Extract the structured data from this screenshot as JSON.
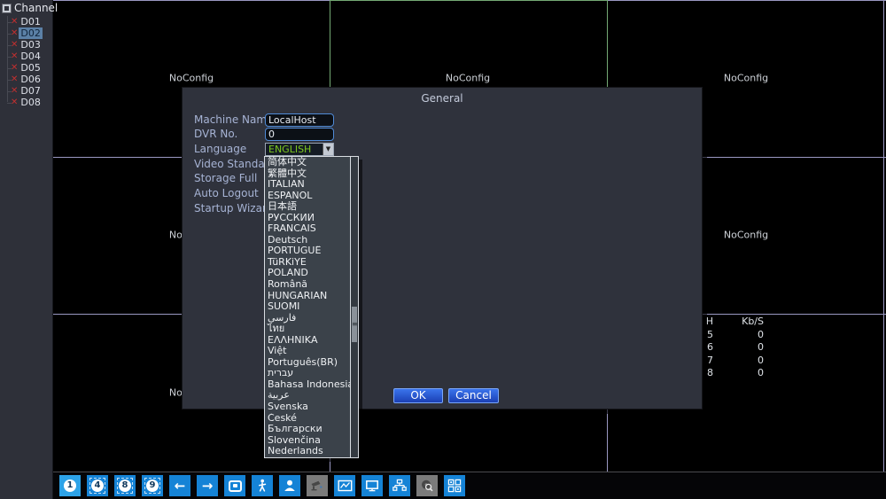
{
  "colors": {
    "accent_blue": "#1583d6",
    "active_blue": "#2da3e8",
    "combo_text_green": "#7cc81e",
    "selected_cell_border_green": "#74aa74",
    "grid_line_lavender": "#9a98c2",
    "channel_x_red": "#c22f2f",
    "button_blue": "#2356d8",
    "dialog_bg": "#2f323c"
  },
  "icons": {
    "channel_status": "✕",
    "dropdown_arrow": "▼",
    "arrow_left": "←",
    "arrow_right": "→",
    "scroll_grip": "≡"
  },
  "sidebar": {
    "title": "Channel",
    "channels": [
      {
        "label": "D01",
        "selected": false
      },
      {
        "label": "D02",
        "selected": true
      },
      {
        "label": "D03",
        "selected": false
      },
      {
        "label": "D04",
        "selected": false
      },
      {
        "label": "D05",
        "selected": false
      },
      {
        "label": "D06",
        "selected": false
      },
      {
        "label": "D07",
        "selected": false
      },
      {
        "label": "D08",
        "selected": false
      }
    ]
  },
  "video_grid": {
    "no_config_label": "NoConfig",
    "bitrate_table": {
      "headers": {
        "ch": "H",
        "kbs": "Kb/S"
      },
      "rows": [
        {
          "ch": "5",
          "kbs": "0"
        },
        {
          "ch": "6",
          "kbs": "0"
        },
        {
          "ch": "7",
          "kbs": "0"
        },
        {
          "ch": "8",
          "kbs": "0"
        }
      ]
    }
  },
  "dialog": {
    "title": "General",
    "fields": [
      {
        "label": "Machine Name",
        "value": "LocalHost"
      },
      {
        "label": "DVR No.",
        "value": "0"
      },
      {
        "label": "Language",
        "value": "ENGLISH"
      },
      {
        "label": "Video Standard",
        "value": ""
      },
      {
        "label": "Storage Full",
        "value": ""
      },
      {
        "label": "Auto Logout",
        "value": ""
      },
      {
        "label": "Startup Wizard",
        "value": ""
      }
    ],
    "language_options": [
      "简体中文",
      "繁體中文",
      "ITALIAN",
      "ESPAÑOL",
      "日本語",
      "РУССКИЙ",
      "FRANCAIS",
      "Deutsch",
      "PORTUGUÊ",
      "TüRKiYE",
      "POLAND",
      "Română",
      "HUNGARIAN",
      "SUOMI",
      "فارسي",
      "ไทย",
      "ΕΛΛΗΝΙΚΑ",
      "Việt",
      "Português(BR)",
      "עברית",
      "Bahasa Indonesia",
      "عربية",
      "Svenska",
      "České",
      "Български",
      "Slovenčina",
      "Nederlands"
    ],
    "ok_label": "OK",
    "cancel_label": "Cancel"
  },
  "toolbar": {
    "buttons": [
      {
        "name": "view-single",
        "label": "1",
        "state": "active"
      },
      {
        "name": "view-quad",
        "label": "4",
        "state": "normal"
      },
      {
        "name": "view-eight",
        "label": "8",
        "state": "normal"
      },
      {
        "name": "view-nine",
        "label": "9",
        "state": "normal"
      },
      {
        "name": "prev-page",
        "label": "",
        "state": "normal"
      },
      {
        "name": "next-page",
        "label": "",
        "state": "normal"
      },
      {
        "name": "tour",
        "label": "",
        "state": "normal"
      },
      {
        "name": "pedestrian-detect",
        "label": "",
        "state": "normal"
      },
      {
        "name": "user-account",
        "label": "",
        "state": "normal"
      },
      {
        "name": "camera-device",
        "label": "",
        "state": "disabled"
      },
      {
        "name": "playback-chart",
        "label": "",
        "state": "normal"
      },
      {
        "name": "display-output",
        "label": "",
        "state": "normal"
      },
      {
        "name": "network",
        "label": "",
        "state": "normal"
      },
      {
        "name": "disk-search",
        "label": "",
        "state": "disabled"
      },
      {
        "name": "multi-channel",
        "label": "",
        "state": "normal"
      }
    ]
  }
}
